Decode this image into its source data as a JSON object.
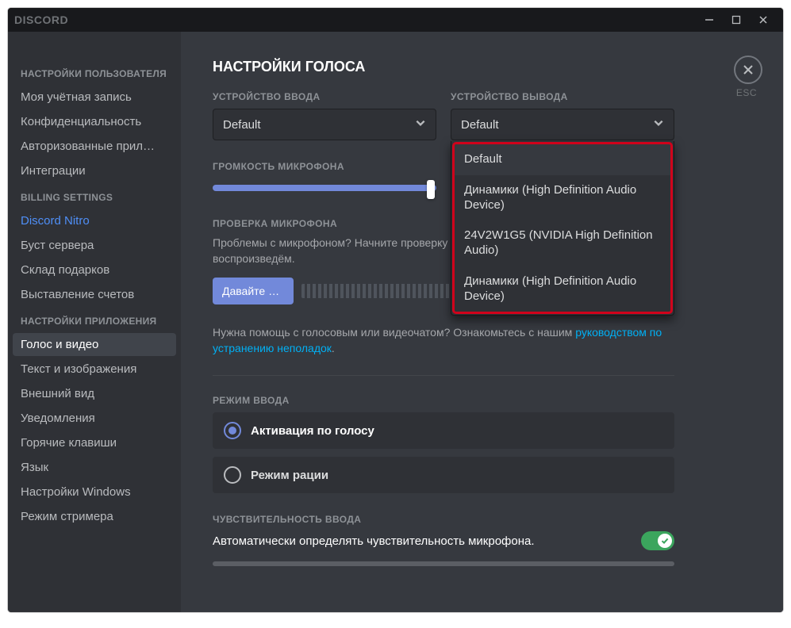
{
  "app": {
    "title": "DISCORD",
    "esc": "ESC"
  },
  "sidebar": {
    "sections": [
      {
        "header": "НАСТРОЙКИ ПОЛЬЗОВАТЕЛЯ",
        "items": [
          {
            "label": "Моя учётная запись",
            "name": "sidebar-item-account"
          },
          {
            "label": "Конфиденциальность",
            "name": "sidebar-item-privacy"
          },
          {
            "label": "Авторизованные прил…",
            "name": "sidebar-item-authorized-apps"
          },
          {
            "label": "Интеграции",
            "name": "sidebar-item-integrations"
          }
        ]
      },
      {
        "header": "BILLING SETTINGS",
        "items": [
          {
            "label": "Discord Nitro",
            "name": "sidebar-item-discord-nitro",
            "nitro": true
          },
          {
            "label": "Буст сервера",
            "name": "sidebar-item-server-boost"
          },
          {
            "label": "Склад подарков",
            "name": "sidebar-item-gift-inventory"
          },
          {
            "label": "Выставление счетов",
            "name": "sidebar-item-billing"
          }
        ]
      },
      {
        "header": "НАСТРОЙКИ ПРИЛОЖЕНИЯ",
        "items": [
          {
            "label": "Голос и видео",
            "name": "sidebar-item-voice-video",
            "active": true
          },
          {
            "label": "Текст и изображения",
            "name": "sidebar-item-text-images"
          },
          {
            "label": "Внешний вид",
            "name": "sidebar-item-appearance"
          },
          {
            "label": "Уведомления",
            "name": "sidebar-item-notifications"
          },
          {
            "label": "Горячие клавиши",
            "name": "sidebar-item-keybinds"
          },
          {
            "label": "Язык",
            "name": "sidebar-item-language"
          },
          {
            "label": "Настройки Windows",
            "name": "sidebar-item-windows-settings"
          },
          {
            "label": "Режим стримера",
            "name": "sidebar-item-streamer-mode"
          }
        ]
      }
    ]
  },
  "page": {
    "title": "НАСТРОЙКИ ГОЛОСА",
    "input_device_label": "УСТРОЙСТВО ВВОДА",
    "output_device_label": "УСТРОЙСТВО ВЫВОДА",
    "input_device_value": "Default",
    "output_device_value": "Default",
    "output_options": [
      "Default",
      "Динамики (High Definition Audio Device)",
      "24V2W1G5 (NVIDIA High Definition Audio)",
      "Динамики (High Definition Audio Device)"
    ],
    "mic_volume_label": "ГРОМКОСТЬ МИКРОФОНА",
    "mic_test_label": "ПРОВЕРКА МИКРОФОНА",
    "mic_test_help": "Проблемы с микрофоном? Начните проверку и скажите что-нибудь — мы воспроизведём.",
    "mic_test_button": "Давайте пр…",
    "help_prefix": "Нужна помощь с голосовым или видеочатом? Ознакомьтесь с нашим ",
    "help_link": "руководством по устранению неполадок",
    "help_suffix": ".",
    "input_mode_label": "РЕЖИМ ВВОДА",
    "input_mode_options": [
      {
        "label": "Активация по голосу",
        "name": "radio-voice-activity",
        "selected": true
      },
      {
        "label": "Режим рации",
        "name": "radio-push-to-talk",
        "selected": false
      }
    ],
    "sensitivity_label": "ЧУВСТВИТЕЛЬНОСТЬ ВВОДА",
    "auto_sensitivity_label": "Автоматически определять чувствительность микрофона.",
    "auto_sensitivity_on": true
  }
}
